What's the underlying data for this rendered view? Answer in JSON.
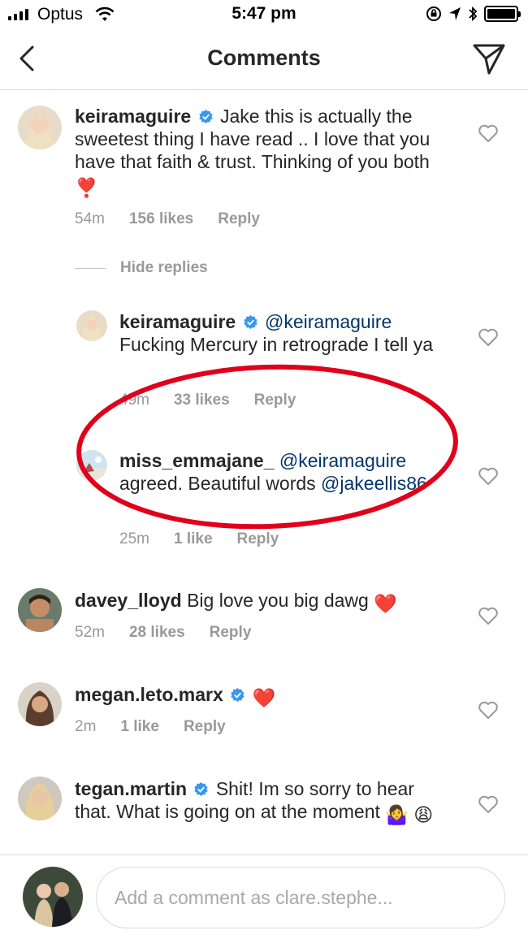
{
  "status_bar": {
    "carrier": "Optus",
    "time": "5:47 pm"
  },
  "nav": {
    "title": "Comments"
  },
  "comments": [
    {
      "username": "keiramaguire",
      "verified": true,
      "text": "Jake this is actually the sweetest thing I have read .. I love that you have that faith & trust. Thinking of you both",
      "emoji": "❣️",
      "time": "54m",
      "likes": "156 likes",
      "reply": "Reply"
    },
    {
      "username": "davey_lloyd",
      "verified": false,
      "text": "Big love you big dawg",
      "emoji": "❤️",
      "time": "52m",
      "likes": "28 likes",
      "reply": "Reply"
    },
    {
      "username": "megan.leto.marx",
      "verified": true,
      "text": "",
      "emoji": "❤️",
      "time": "2m",
      "likes": "1 like",
      "reply": "Reply"
    },
    {
      "username": "tegan.martin",
      "verified": true,
      "text": "Shit! Im so sorry to hear that. What is going on at the moment",
      "emoji": "🤷‍♀️",
      "emoji2": "😩"
    }
  ],
  "hide_replies": "Hide replies",
  "replies": [
    {
      "username": "keiramaguire",
      "verified": true,
      "mention": "@keiramaguire",
      "text": "Fucking Mercury in retrograde I tell ya",
      "time": "49m",
      "likes": "33 likes",
      "reply": "Reply"
    },
    {
      "username": "miss_emmajane_",
      "verified": false,
      "mention": "@keiramaguire",
      "text": "agreed.  Beautiful words",
      "mention2": "@jakeellis86",
      "time": "25m",
      "likes": "1 like",
      "reply": "Reply"
    }
  ],
  "composer": {
    "placeholder": "Add a comment as clare.stephe..."
  },
  "colors": {
    "annotation": "#e0001b",
    "verified": "#3897f0",
    "mention": "#003569",
    "muted": "#999999"
  }
}
